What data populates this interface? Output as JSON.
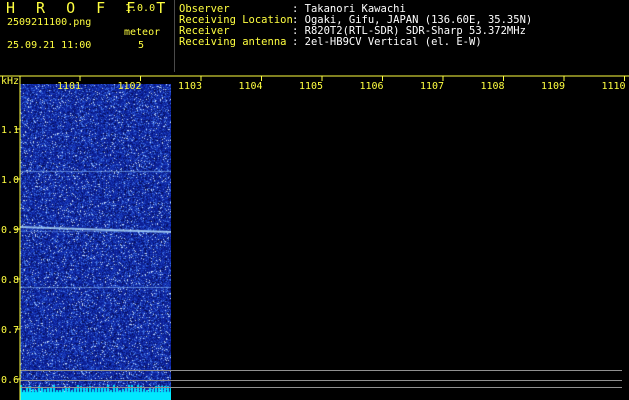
{
  "header": {
    "app_name": "H R O F F T",
    "version": "1.0.0",
    "file_name": "2509211100.png",
    "meteor_label": "meteor",
    "timestamp": "25.09.21 11:00",
    "meteor_count": "5"
  },
  "station_info": [
    {
      "key": "Observer",
      "value": ": Takanori Kawachi"
    },
    {
      "key": "Receiving Location",
      "value": ": Ogaki, Gifu, JAPAN (136.60E, 35.35N)"
    },
    {
      "key": "Receiver",
      "value": ": R820T2(RTL-SDR) SDR-Sharp 53.372MHz"
    },
    {
      "key": "Receiving antenna",
      "value": ": 2el-HB9CV Vertical (el. E-W)"
    }
  ],
  "axes": {
    "y_unit": "kHz",
    "x_ticks": [
      "1101",
      "1102",
      "1103",
      "1104",
      "1105",
      "1106",
      "1107",
      "1108",
      "1109",
      "1110"
    ],
    "y_ticks": [
      "1.1",
      "1.0",
      "0.9",
      "0.8",
      "0.7",
      "0.6"
    ]
  },
  "colors": {
    "label": "#ffff40",
    "waterfall_base": "#1028a0",
    "trail": "#a8d8ff",
    "bottom_band": "#00e8ff"
  }
}
